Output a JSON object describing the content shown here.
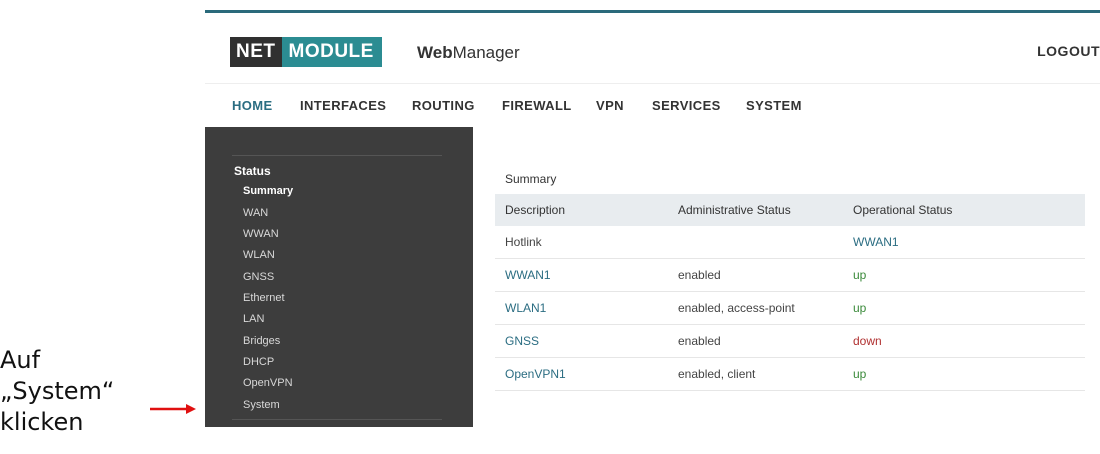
{
  "annotation": {
    "lines": [
      "Auf",
      "„System“",
      "klicken"
    ],
    "arrow_color": "#e01010"
  },
  "brand": {
    "net": "NET",
    "module": "MODULE",
    "webmanager_bold": "Web",
    "webmanager_rest": "Manager"
  },
  "header": {
    "logout_label": "LOGOUT"
  },
  "nav": {
    "items": [
      {
        "label": "HOME",
        "active": true
      },
      {
        "label": "INTERFACES"
      },
      {
        "label": "ROUTING"
      },
      {
        "label": "FIREWALL"
      },
      {
        "label": "VPN"
      },
      {
        "label": "SERVICES"
      },
      {
        "label": "SYSTEM"
      }
    ]
  },
  "sidebar": {
    "section_title": "Status",
    "items": [
      {
        "label": "Summary",
        "active": true
      },
      {
        "label": "WAN"
      },
      {
        "label": "WWAN"
      },
      {
        "label": "WLAN"
      },
      {
        "label": "GNSS"
      },
      {
        "label": "Ethernet"
      },
      {
        "label": "LAN"
      },
      {
        "label": "Bridges"
      },
      {
        "label": "DHCP"
      },
      {
        "label": "OpenVPN"
      },
      {
        "label": "System"
      }
    ]
  },
  "main": {
    "title": "Summary",
    "columns": [
      "Description",
      "Administrative Status",
      "Operational Status"
    ],
    "rows": [
      {
        "description": "Hotlink",
        "admin": "",
        "oper": "WWAN1"
      },
      {
        "description": "WWAN1",
        "admin": "enabled",
        "oper": "up"
      },
      {
        "description": "WLAN1",
        "admin": "enabled, access-point",
        "oper": "up"
      },
      {
        "description": "GNSS",
        "admin": "enabled",
        "oper": "down"
      },
      {
        "description": "OpenVPN1",
        "admin": "enabled, client",
        "oper": "up"
      }
    ]
  },
  "colors": {
    "accent": "#2b6d82",
    "brand_teal": "#2b8c92",
    "sidebar_bg": "#3d3d3d",
    "status_up": "#3a8a3a",
    "status_down": "#b03030"
  }
}
